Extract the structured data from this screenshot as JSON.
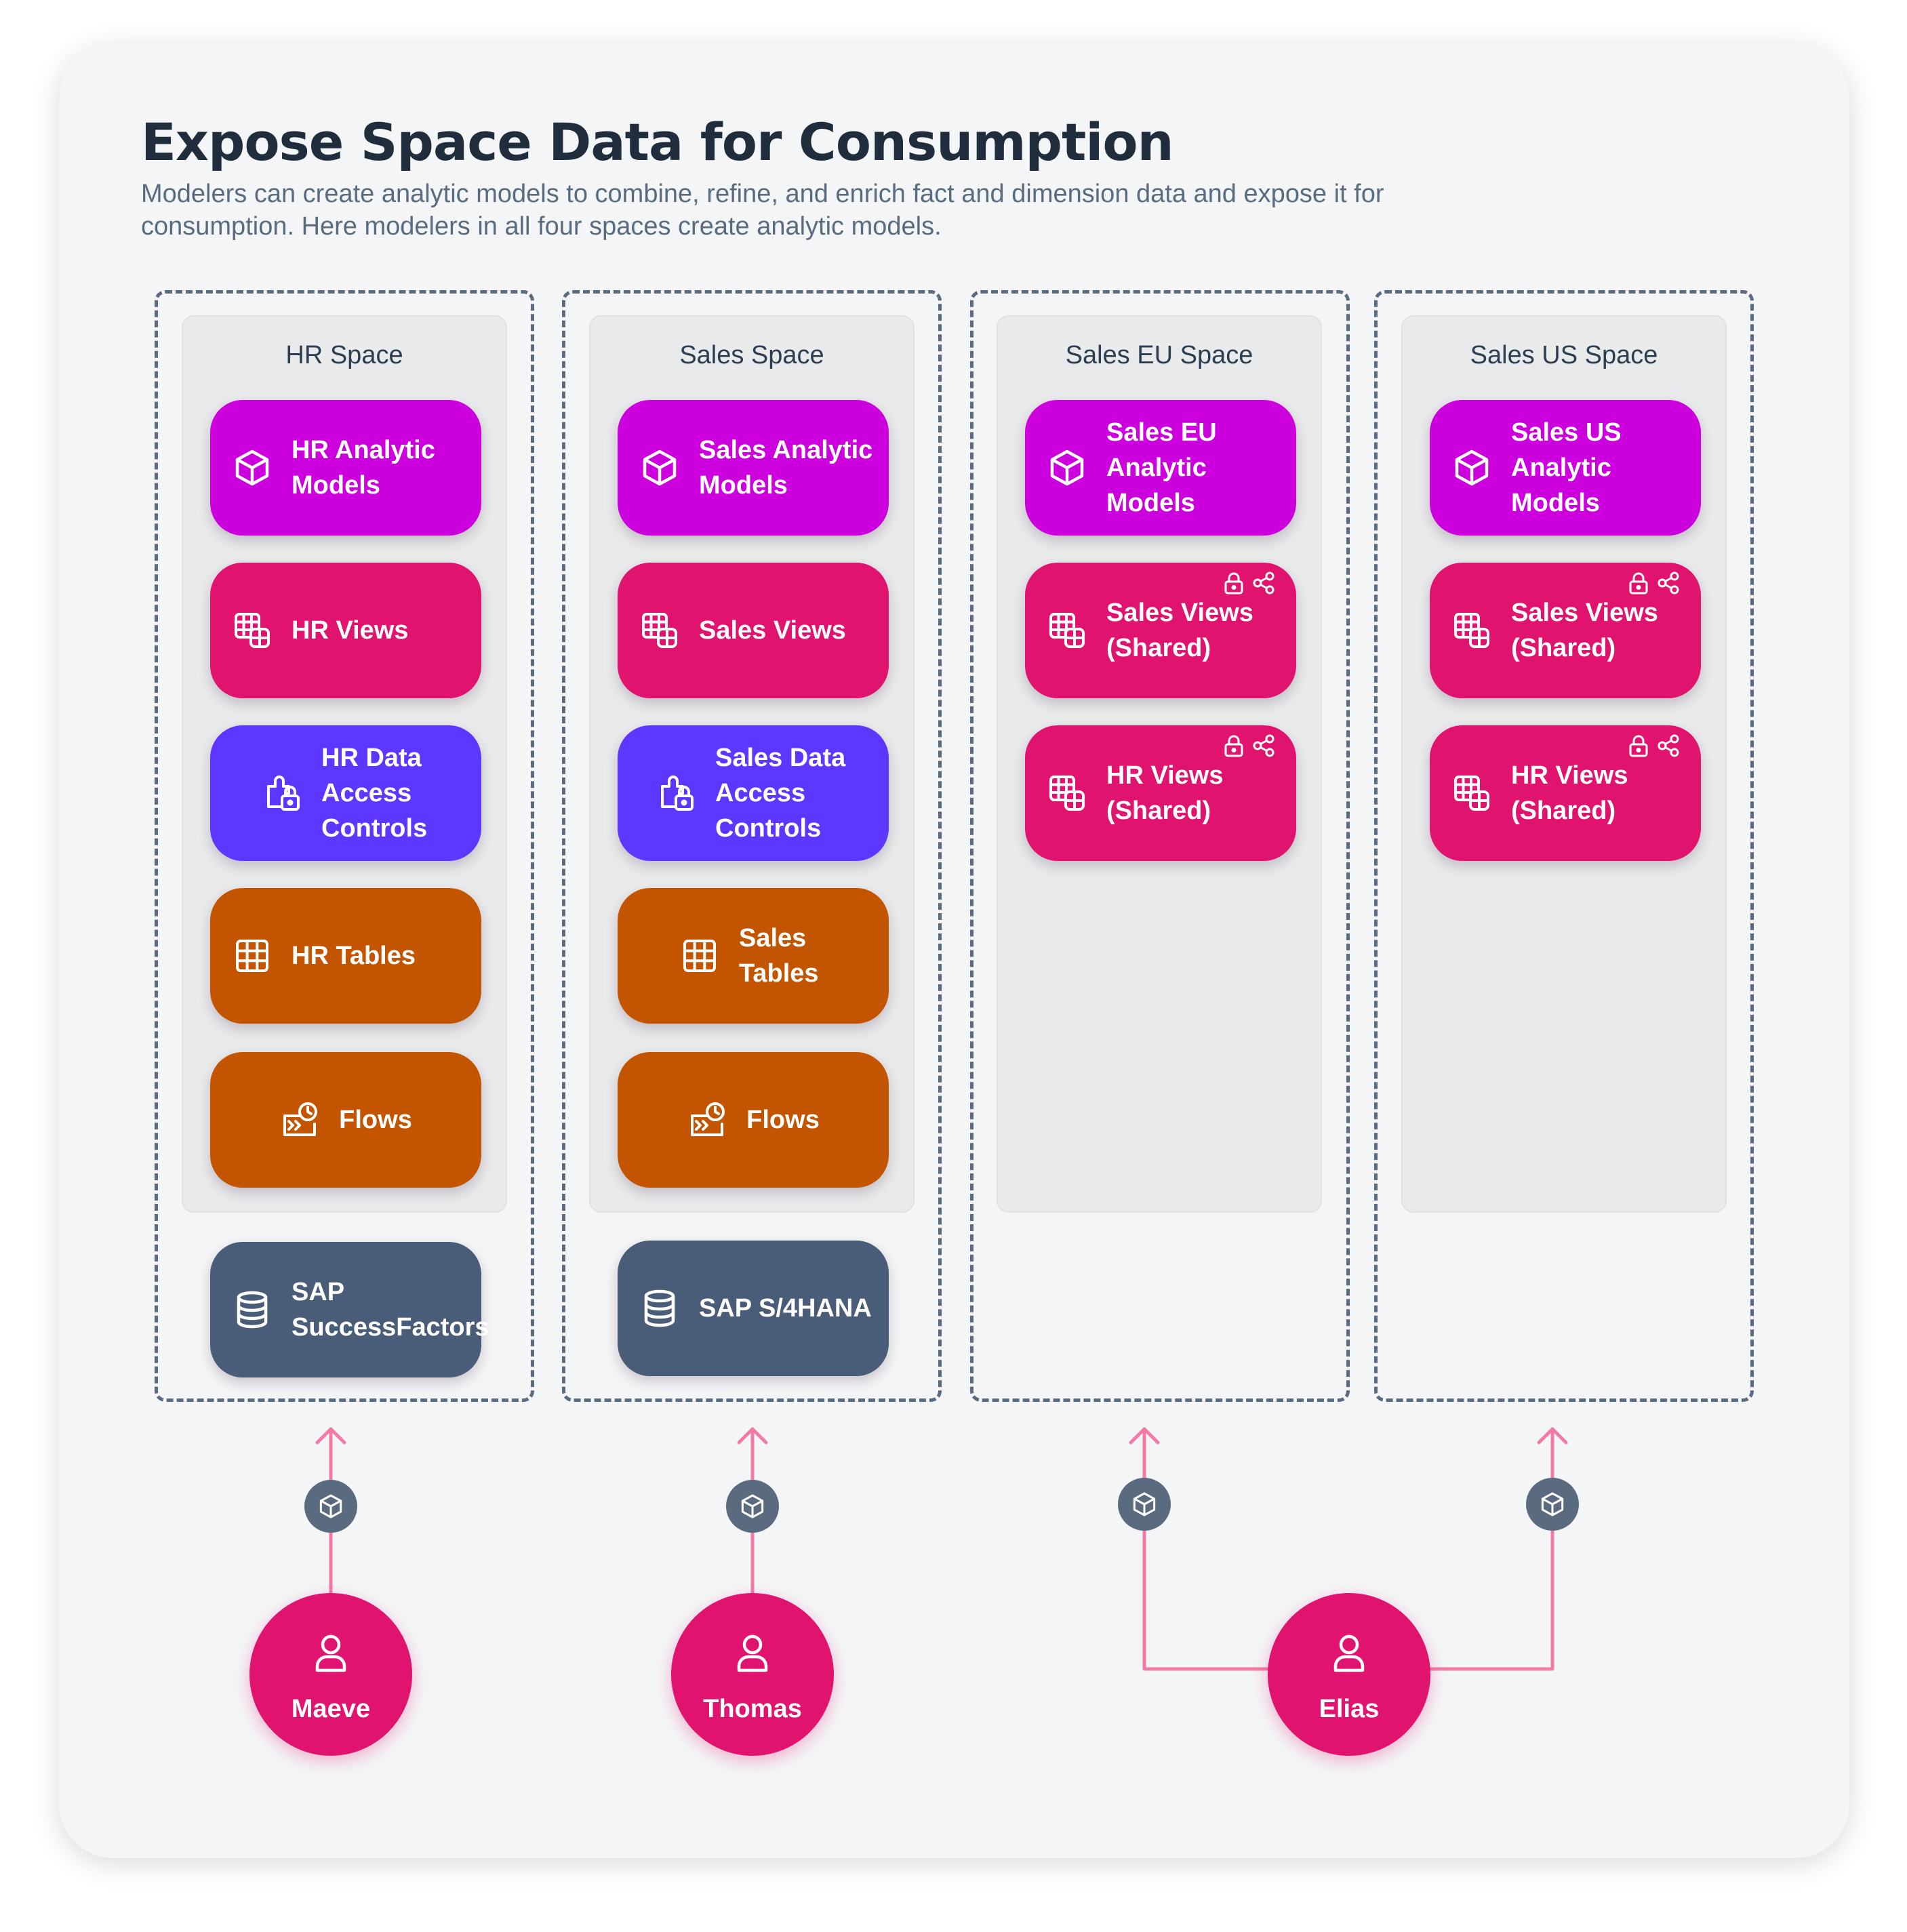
{
  "header": {
    "title": "Expose Space Data for Consumption",
    "subtitle": "Modelers can create analytic models to combine, refine, and enrich fact and dimension data and expose it for consumption. Here modelers in all four spaces create analytic models."
  },
  "colors": {
    "analytic_models": "#cc00dc",
    "views": "#e0136f",
    "data_access_controls": "#5d36ff",
    "tables_and_flows": "#c35500",
    "source_system": "#4a5d78",
    "user": "#e0136f",
    "connector": "#f27aa6",
    "dashed_border": "#5a6b80"
  },
  "spaces": [
    {
      "name": "HR Space",
      "items": [
        {
          "label": "HR Analytic Models",
          "icon": "cube-icon"
        },
        {
          "label": "HR Views",
          "icon": "view-icon"
        },
        {
          "label": "HR Data Access Controls",
          "icon": "access-control-icon"
        },
        {
          "label": "HR Tables",
          "icon": "table-icon"
        },
        {
          "label": "Flows",
          "icon": "flow-icon"
        }
      ],
      "source": {
        "label": "SAP SuccessFactors",
        "icon": "database-icon"
      }
    },
    {
      "name": "Sales Space",
      "items": [
        {
          "label": "Sales Analytic Models",
          "icon": "cube-icon"
        },
        {
          "label": "Sales Views",
          "icon": "view-icon"
        },
        {
          "label": "Sales Data Access Controls",
          "icon": "access-control-icon"
        },
        {
          "label": "Sales Tables",
          "icon": "table-icon"
        },
        {
          "label": "Flows",
          "icon": "flow-icon"
        }
      ],
      "source": {
        "label": "SAP S/4HANA",
        "icon": "database-icon"
      }
    },
    {
      "name": "Sales EU Space",
      "items": [
        {
          "label": "Sales EU Analytic Models",
          "icon": "cube-icon"
        },
        {
          "label": "Sales Views (Shared)",
          "icon": "view-icon",
          "badges": [
            "lock-icon",
            "share-icon"
          ]
        },
        {
          "label": "HR Views (Shared)",
          "icon": "view-icon",
          "badges": [
            "lock-icon",
            "share-icon"
          ]
        }
      ]
    },
    {
      "name": "Sales US Space",
      "items": [
        {
          "label": "Sales US Analytic Models",
          "icon": "cube-icon"
        },
        {
          "label": "Sales Views (Shared)",
          "icon": "view-icon",
          "badges": [
            "lock-icon",
            "share-icon"
          ]
        },
        {
          "label": "HR Views (Shared)",
          "icon": "view-icon",
          "badges": [
            "lock-icon",
            "share-icon"
          ]
        }
      ]
    }
  ],
  "users": [
    {
      "name": "Maeve",
      "icon": "user-icon"
    },
    {
      "name": "Thomas",
      "icon": "user-icon"
    },
    {
      "name": "Elias",
      "icon": "user-icon"
    }
  ],
  "connector_icon": "cube-icon"
}
